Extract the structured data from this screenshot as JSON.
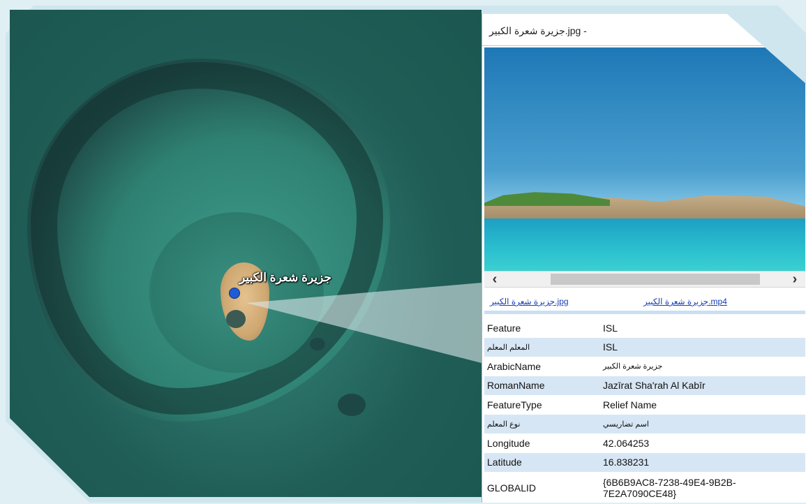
{
  "map": {
    "label": "جزيرة شعرة الكبير"
  },
  "panel": {
    "title": "جزيرة شعرة الكبير.jpg -"
  },
  "scroll": {
    "left_glyph": "‹",
    "right_glyph": "›"
  },
  "links": {
    "jpg": "جزيرة شعرة الكبير.jpg",
    "mp4": "جزيرة شعرة الكبير.mp4"
  },
  "attributes": [
    {
      "key": "Feature",
      "value": "ISL"
    },
    {
      "key": "المعلم المعلم",
      "value": "ISL"
    },
    {
      "key": "ArabicName",
      "value": "جزيرة شعرة الكبير"
    },
    {
      "key": "RomanName",
      "value": "Jazīrat Sha'rah Al Kabīr"
    },
    {
      "key": "FeatureType",
      "value": "Relief Name"
    },
    {
      "key": "نوع المعلم",
      "value": "اسم تضاريسي"
    },
    {
      "key": "Longitude",
      "value": "42.064253"
    },
    {
      "key": "Latitude",
      "value": "16.838231"
    },
    {
      "key": "GLOBALID",
      "value": "{6B6B9AC8-7238-49E4-9B2B-7E2A7090CE48}"
    }
  ]
}
